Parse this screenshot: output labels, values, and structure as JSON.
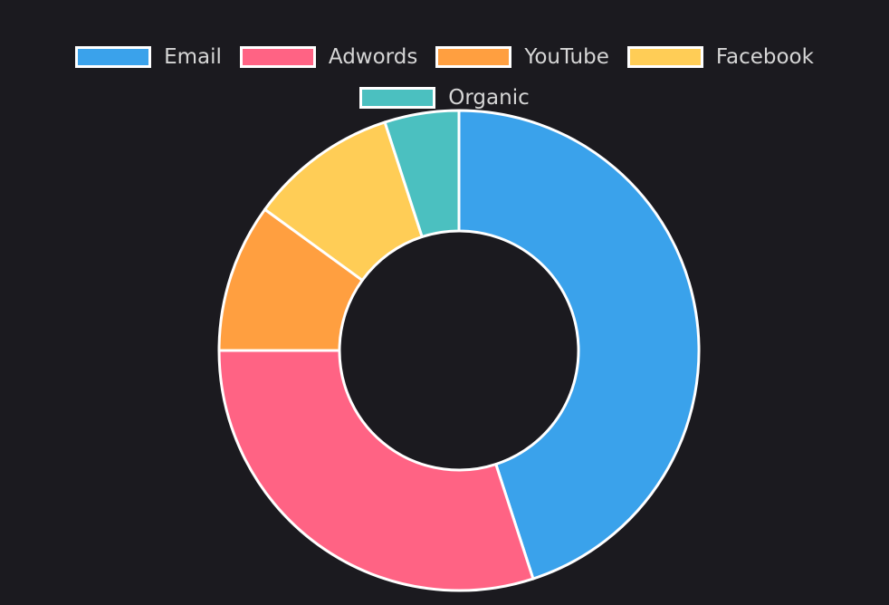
{
  "chart_data": {
    "type": "pie",
    "variant": "doughnut",
    "categories": [
      "Email",
      "Adwords",
      "YouTube",
      "Facebook",
      "Organic"
    ],
    "values": [
      45,
      30,
      10,
      10,
      5
    ],
    "colors": [
      "#3aa2eb",
      "#ff6384",
      "#ff9f40",
      "#ffcd56",
      "#4bc0c0"
    ],
    "border_color": "#ffffff",
    "background_color": "#1b1a1f",
    "legend_position": "top",
    "legend_text_color": "#d6d6d6"
  }
}
